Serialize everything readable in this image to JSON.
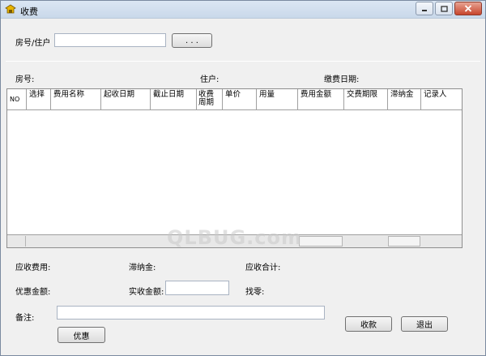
{
  "window": {
    "title": "收费"
  },
  "search": {
    "label": "房号/住户",
    "value": "",
    "browse_label": ". . ."
  },
  "info": {
    "room_label": "房号:",
    "resident_label": "住户:",
    "pay_date_label": "缴费日期:"
  },
  "grid": {
    "columns": [
      "NO",
      "选择",
      "费用名称",
      "起收日期",
      "截止日期",
      "收费周期",
      "单价",
      "用量",
      "费用金额",
      "交费期限",
      "滞纳金",
      "记录人"
    ],
    "rows": []
  },
  "summary": {
    "receivable_label": "应收费用:",
    "late_fee_label": "滞纳金:",
    "total_label": "应收合计:",
    "discount_label": "优惠金额:",
    "received_label": "实收金额:",
    "received_value": "",
    "change_label": "找零:",
    "note_label": "备注:",
    "note_value": ""
  },
  "buttons": {
    "discount": "优惠",
    "collect": "收款",
    "exit": "退出"
  },
  "watermark": "QLBUG.com",
  "colors": {
    "title_bg": "#dbe6f3",
    "close_button": "#c7452c"
  }
}
